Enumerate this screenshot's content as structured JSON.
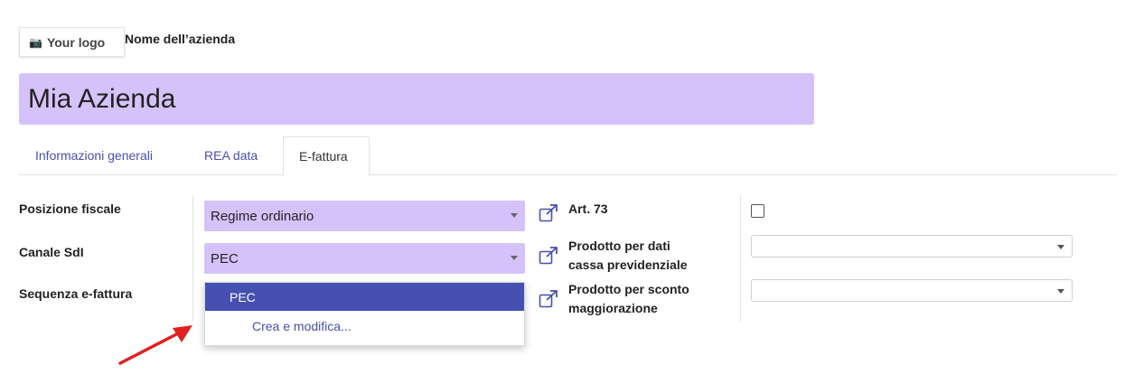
{
  "header": {
    "logo_camera_icon": "📷",
    "logo_text": "Your logo",
    "company_name_label": "Nome dell’azienda",
    "company_name_value": "Mia Azienda"
  },
  "tabs": [
    {
      "label": "Informazioni generali",
      "active": false
    },
    {
      "label": "REA data",
      "active": false
    },
    {
      "label": "E-fattura",
      "active": true
    }
  ],
  "form": {
    "left": {
      "posizione_fiscale_label": "Posizione fiscale",
      "posizione_fiscale_value": "Regime ordinario",
      "canale_sdi_label": "Canale SdI",
      "canale_sdi_value": "PEC",
      "sequenza_label": "Sequenza e-fattura"
    },
    "right": {
      "art73_label": "Art. 73",
      "art73_checked": false,
      "prodotto_cassa_label_line1": "Prodotto per dati",
      "prodotto_cassa_label_line2": "cassa previdenziale",
      "prodotto_sconto_label_line1": "Prodotto per sconto",
      "prodotto_sconto_label_line2": "maggiorazione"
    }
  },
  "dropdown": {
    "selected_option": "PEC",
    "create_edit": "Crea e modifica..."
  },
  "colors": {
    "accent": "#4650b1",
    "required_field": "#d5c2fb",
    "annotation_arrow": "#e02020"
  }
}
